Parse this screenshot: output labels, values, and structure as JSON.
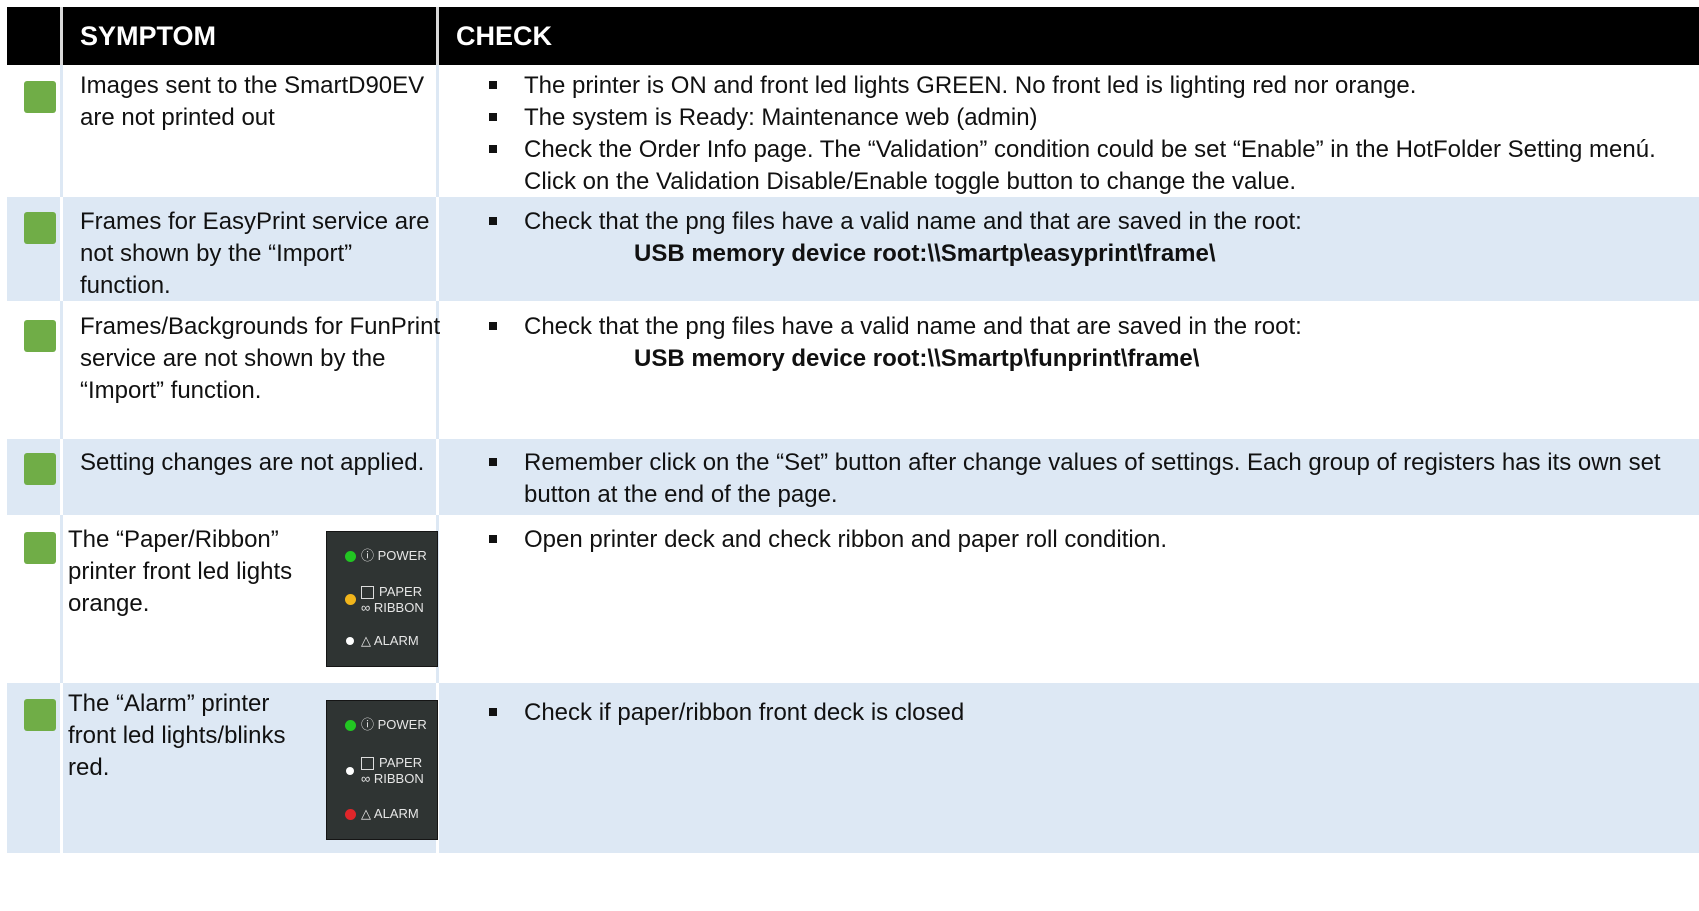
{
  "header": {
    "symptom": "SYMPTOM",
    "check": "CHECK"
  },
  "rows": [
    {
      "symptom": [
        "Images sent to the SmartD90EV",
        "are not printed out"
      ],
      "checks": [
        [
          "The printer is ON and front led lights GREEN. No front led is lighting red nor orange."
        ],
        [
          "The system is Ready: Maintenance  web (admin)"
        ],
        [
          "Check the Order Info page. The “Validation” condition could be set “Enable” in the HotFolder Setting menú.",
          "Click on the Validation Disable/Enable toggle button to change the value."
        ]
      ]
    },
    {
      "symptom": [
        "Frames for EasyPrint service are",
        "not shown by the “Import”",
        "function."
      ],
      "checks": [
        [
          "Check that the png files have a valid name and that are saved in the root:"
        ]
      ],
      "path": "USB memory device root:\\\\Smartp\\easyprint\\frame\\"
    },
    {
      "symptom": [
        "Frames/Backgrounds for FunPrint",
        "service are not shown by the",
        "“Import” function."
      ],
      "checks": [
        [
          "Check that the png files have a valid name and that are saved in the root:"
        ]
      ],
      "path": "USB memory device root:\\\\Smartp\\funprint\\frame\\"
    },
    {
      "symptom": [
        "Setting changes are not applied."
      ],
      "checks": [
        [
          "Remember click on the “Set” button after change values of settings. Each group of registers has its own set",
          "button at the end of the page."
        ]
      ]
    },
    {
      "symptom": [
        "The “Paper/Ribbon”",
        "printer front led lights",
        "orange."
      ],
      "checks": [
        [
          "Open printer deck and check ribbon and paper roll condition."
        ]
      ],
      "panel": {
        "power": "POWER",
        "paper": "PAPER",
        "ribbon": "RIBBON",
        "alarm": "ALARM"
      }
    },
    {
      "symptom": [
        "The “Alarm” printer",
        "front led lights/blinks",
        "red."
      ],
      "checks": [
        [
          "Check if paper/ribbon front deck is closed"
        ]
      ],
      "panel": {
        "power": "POWER",
        "paper": "PAPER",
        "ribbon": "RIBBON",
        "alarm": "ALARM"
      }
    }
  ],
  "colors": {
    "header_bg": "#000000",
    "row_alt_bg": "#dde8f4",
    "status_square": "#70ad47",
    "led_green": "#22c522",
    "led_orange": "#f2b51b",
    "led_red": "#e0262a",
    "led_off": "#ffffff"
  }
}
